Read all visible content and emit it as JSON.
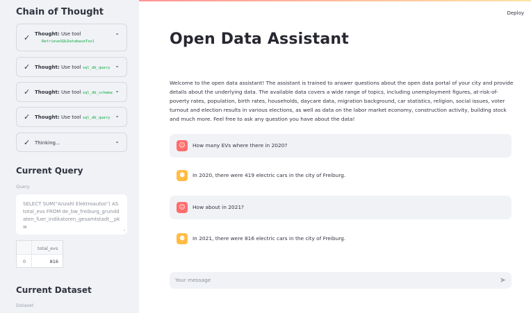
{
  "sidebar": {
    "chain_title": "Chain of Thought",
    "thoughts": [
      {
        "prefix": "Thought:",
        "text": "Use tool",
        "tool": "RetrieveSQLDatabaseTool"
      },
      {
        "prefix": "Thought:",
        "text": "Use tool",
        "tool": "sql_db_query"
      },
      {
        "prefix": "Thought:",
        "text": "Use tool",
        "tool": "sql_db_schema"
      },
      {
        "prefix": "Thought:",
        "text": "Use tool",
        "tool": "sql_db_query"
      },
      {
        "prefix": "",
        "text": "Thinking...",
        "tool": ""
      }
    ],
    "current_query_title": "Current Query",
    "query_label": "Query",
    "query_text": "SELECT SUM(\"Anzahl Elektroautos\") AS total_evs FROM de_bw_freiburg_grunddaten_fuer_indikatoren_gesamtstadt__pkw",
    "dataframe": {
      "column": "total_evs",
      "rows": [
        {
          "index": "0",
          "value": "816"
        }
      ]
    },
    "current_dataset_title": "Current Dataset",
    "dataset_label": "Dataset"
  },
  "header": {
    "deploy_label": "Deploy"
  },
  "main": {
    "title": "Open Data Assistant",
    "intro": "Welcome to the open data assistant! The assistant is trained to answer questions about the open data portal of your city and provide details about the underlying data. The available data covers a wide range of topics, including unemployment figures, at-risk-of-poverty rates, population, birth rates, households, daycare data, migration background, car statistics, religion, social issues, voter turnout and election results in various elections, as well as data on the labor market economy, construction activity, building stock and much more. Feel free to ask any question you have about the data!",
    "messages": [
      {
        "role": "user",
        "text": "How many EVs where there in 2020?"
      },
      {
        "role": "assistant",
        "text": "In 2020, there were 419 electric cars in the city of Freiburg."
      },
      {
        "role": "user",
        "text": "How about in 2021?"
      },
      {
        "role": "assistant",
        "text": "In 2021, there were 816 electric cars in the city of Freiburg."
      }
    ],
    "input_placeholder": "Your message"
  },
  "icons": {
    "check": "check-icon",
    "chevron": "chevron-down-icon",
    "user_avatar": "user-avatar-icon",
    "assistant_avatar": "assistant-avatar-icon",
    "send": "send-icon"
  },
  "colors": {
    "sidebar_bg": "#f0f2f6",
    "code_green": "#09ab3b",
    "user_avatar": "#ff6c6c",
    "assistant_avatar": "#ffbd45"
  }
}
